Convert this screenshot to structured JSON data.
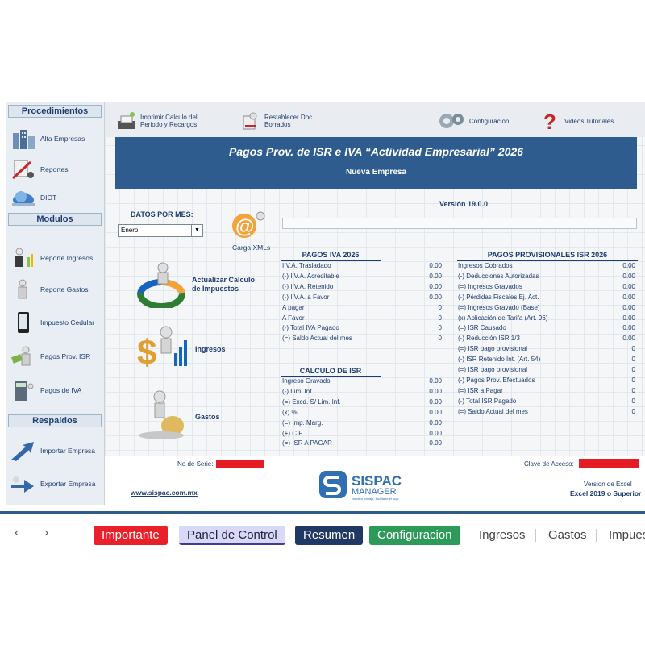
{
  "sidebar": {
    "procedimientos_header": "Procedimientos",
    "modulos_header": "Modulos",
    "respaldos_header": "Respaldos",
    "procedimientos": [
      {
        "label": "Alta Empresas",
        "icon": "buildings-icon"
      },
      {
        "label": "Reportes",
        "icon": "tools-icon"
      },
      {
        "label": "DIOT",
        "icon": "globe-icon"
      }
    ],
    "modulos": [
      {
        "label": "Reporte Ingresos",
        "icon": "person-chart-icon"
      },
      {
        "label": "Reporte Gastos",
        "icon": "person-icon"
      },
      {
        "label": "Impuesto Cedular",
        "icon": "phone-icon"
      },
      {
        "label": "Pagos Prov.  ISR",
        "icon": "person-money-icon"
      },
      {
        "label": "Pagos de IVA",
        "icon": "calculator-person-icon"
      }
    ],
    "respaldos": [
      {
        "label": "Importar Empresa",
        "icon": "import-arrow-icon"
      },
      {
        "label": "Exportar Empresa",
        "icon": "export-arrow-icon"
      }
    ]
  },
  "toolbar": {
    "imprimir": "Imprimir Calculo del\nPeriodo y Recargos",
    "restablecer": "Restablecer Doc.\nBorrados",
    "configuracion": "Configuracion",
    "videos": "Videos Tutoriales"
  },
  "banner": {
    "title": "Pagos Prov. de  ISR e IVA  “Actividad Empresarial” 2026",
    "subtitle": "Nueva Empresa"
  },
  "version": "Versión 19.0.0",
  "datos": {
    "label": "DATOS POR MES:",
    "month": "Enero"
  },
  "carga_xml": "Carga XMLs",
  "actions": {
    "actualizar": "Actualizar Calculo\nde Impuestos",
    "ingresos": "Ingresos",
    "gastos": "Gastos"
  },
  "pagos_iva": {
    "title": "PAGOS IVA 2026",
    "rows": [
      {
        "k": "I.V.A. Trasladado",
        "v": "0.00"
      },
      {
        "k": "(-) I.V.A. Acreditable",
        "v": "0.00"
      },
      {
        "k": "(-) I.V.A. Retenido",
        "v": "0.00"
      },
      {
        "k": "(-) I.V.A. a Favor",
        "v": "0.00"
      },
      {
        "k": "A pagar",
        "v": "0"
      },
      {
        "k": "A Favor",
        "v": "0"
      },
      {
        "k": "(-) Total IVA  Pagado",
        "v": "0"
      },
      {
        "k": "(=) Saldo Actual del mes",
        "v": "0"
      }
    ]
  },
  "calculo_isr": {
    "title": "CALCULO DE ISR",
    "rows": [
      {
        "k": "Ingreso Gravado",
        "v": "0.00"
      },
      {
        "k": "(-) Lim. Inf.",
        "v": "0.00"
      },
      {
        "k": "(=) Excd. S/ Lim. Inf.",
        "v": "0.00"
      },
      {
        "k": "(x) %",
        "v": "0.00"
      },
      {
        "k": "(=) Imp. Marg.",
        "v": "0.00"
      },
      {
        "k": "(+) C.F.",
        "v": "0.00"
      },
      {
        "k": "(=) ISR A PAGAR",
        "v": "0.00"
      }
    ]
  },
  "pagos_isr": {
    "title": "PAGOS PROVISIONALES ISR 2026",
    "rows": [
      {
        "k": "Ingresos Cobrados",
        "v": "0.00"
      },
      {
        "k": "(-) Deducciones Autorizadas",
        "v": "0.00"
      },
      {
        "k": "(=) Ingresos  Gravados",
        "v": "0.00"
      },
      {
        "k": "(-) Pérdidas Fiscales Ej. Act.",
        "v": "0.00"
      },
      {
        "k": "(=) Ingresos  Gravado (Base)",
        "v": "0.00"
      },
      {
        "k": "(x) Aplicación de Tarifa (Art. 96)",
        "v": "0.00"
      },
      {
        "k": "(=) ISR Causado",
        "v": "0.00"
      },
      {
        "k": "(-) Reducción ISR 1/3",
        "v": "0.00"
      },
      {
        "k": "(=) ISR pago provisional",
        "v": "0"
      },
      {
        "k": "(-) ISR Retenido Int. (Art. 54)",
        "v": "0"
      },
      {
        "k": "(=) ISR pago provisional",
        "v": "0"
      },
      {
        "k": "(-) Pagos Prov. Efectuados",
        "v": "0"
      },
      {
        "k": "(=) ISR a Pagar",
        "v": "0"
      },
      {
        "k": "(-) Total ISR  Pagado",
        "v": "0"
      },
      {
        "k": "(=) Saldo Actual del mes",
        "v": "0"
      }
    ]
  },
  "footer": {
    "serie_label": "No de Serie:",
    "clave_label": "Clave de Acceso:",
    "website": "www.sispac.com.mx",
    "logo_top": "SISPAC",
    "logo_bottom": "MANAGER",
    "logo_tagline": "Nuestro trabajo, facilitarte el tuyo",
    "excel_label": "Version de Excel",
    "excel_version": "Excel 2019 o Superior"
  },
  "tabs": [
    {
      "label": "Importante",
      "bg": "#e8202a",
      "fg": "#ffffff"
    },
    {
      "label": "Panel de Control",
      "bg": "#d9d9f7",
      "fg": "#1f1f3f"
    },
    {
      "label": "Resumen",
      "bg": "#1f3864",
      "fg": "#ffffff"
    },
    {
      "label": "Configuracion",
      "bg": "#2e9a5a",
      "fg": "#ffffff"
    },
    {
      "label": "Ingresos",
      "bg": "transparent",
      "fg": "#444444"
    },
    {
      "label": "Gastos",
      "bg": "transparent",
      "fg": "#444444"
    },
    {
      "label": "Impues",
      "bg": "transparent",
      "fg": "#444444"
    }
  ],
  "colors": {
    "brand_blue": "#2f5c8f",
    "text_navy": "#1f3d6e",
    "alert_red": "#e51c24"
  }
}
